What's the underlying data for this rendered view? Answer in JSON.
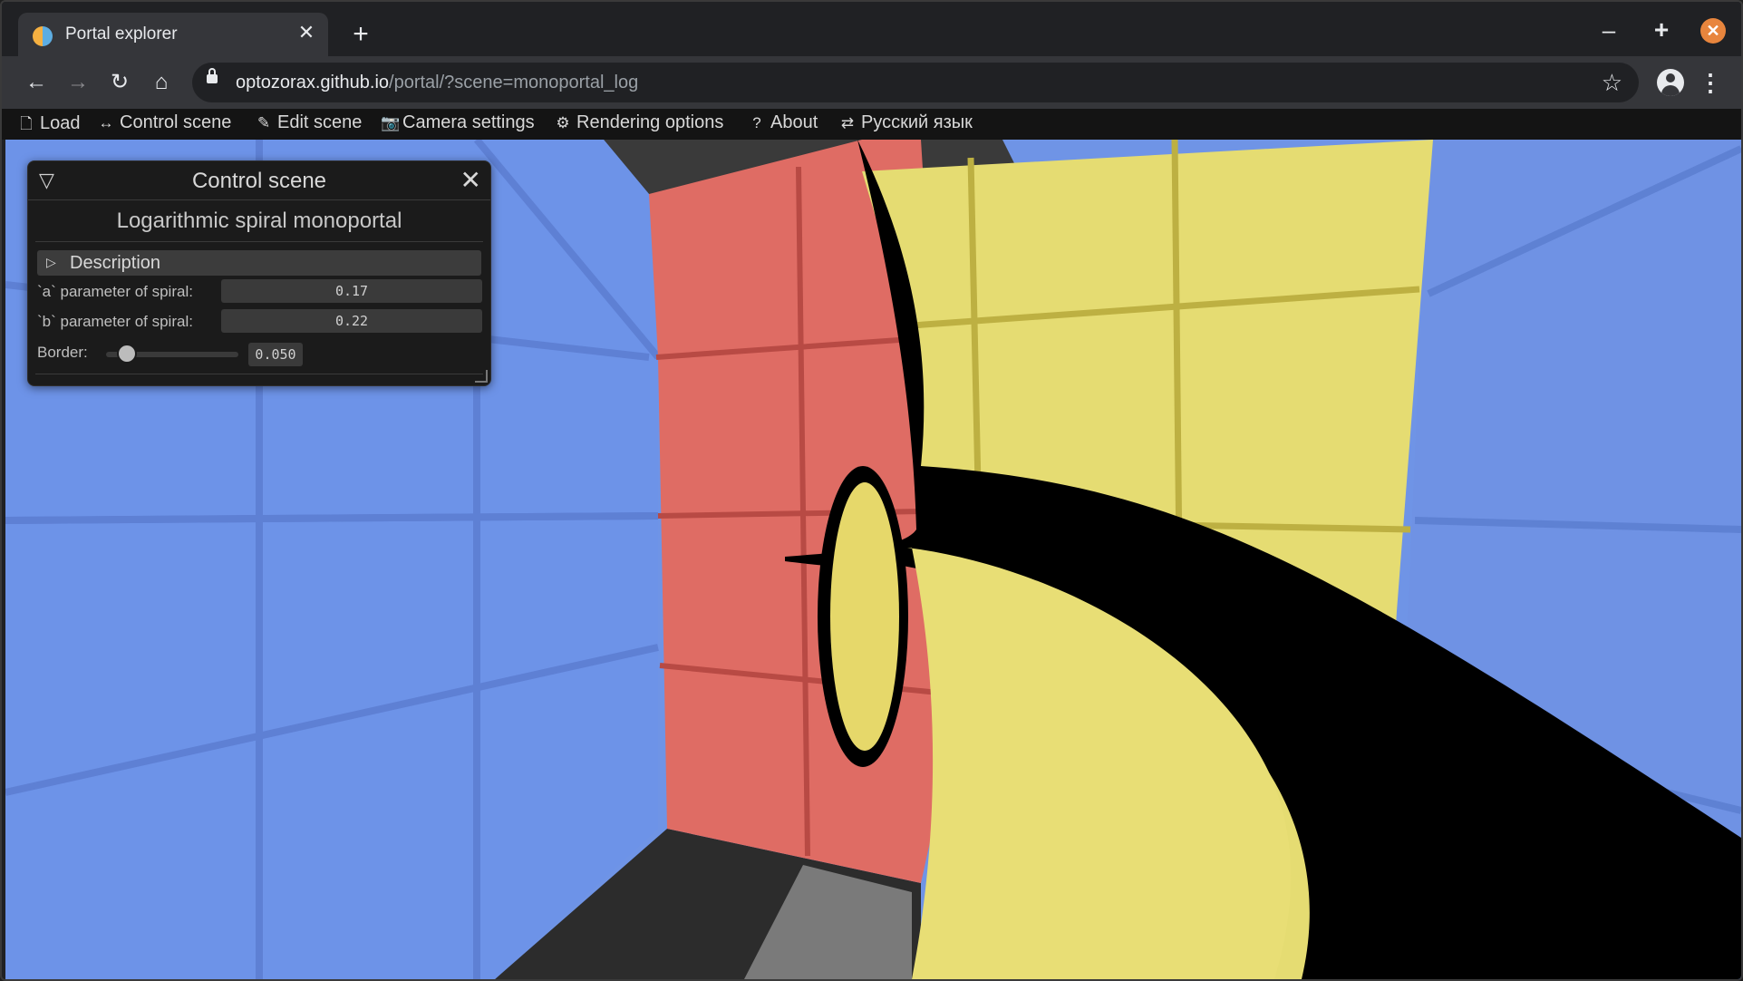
{
  "browser": {
    "tab_title": "Portal explorer",
    "url_host": "optozorax.github.io",
    "url_path": "/portal/?scene=monoportal_log"
  },
  "menu": {
    "items": [
      {
        "label": "Load",
        "icon": "file-icon"
      },
      {
        "label": "Control scene",
        "icon": "arrows-icon"
      },
      {
        "label": "Edit scene",
        "icon": "pencil-icon"
      },
      {
        "label": "Camera settings",
        "icon": "camera-icon"
      },
      {
        "label": "Rendering options",
        "icon": "gear-icon"
      },
      {
        "label": "About",
        "icon": "question-icon"
      },
      {
        "label": "Русский язык",
        "icon": "translate-icon"
      }
    ]
  },
  "panel": {
    "title": "Control scene",
    "scene_name": "Logarithmic spiral monoportal",
    "description_label": "Description",
    "a_label": "`a` parameter of spiral:",
    "a_value": "0.17",
    "b_label": "`b` parameter of spiral:",
    "b_value": "0.22",
    "border_label": "Border:",
    "border_value": "0.050"
  },
  "colors": {
    "wall_blue": "#6f94e6",
    "wall_red": "#d9544c",
    "wall_yellow": "#e3d86a",
    "floor_dark": "#2f2f2f"
  }
}
